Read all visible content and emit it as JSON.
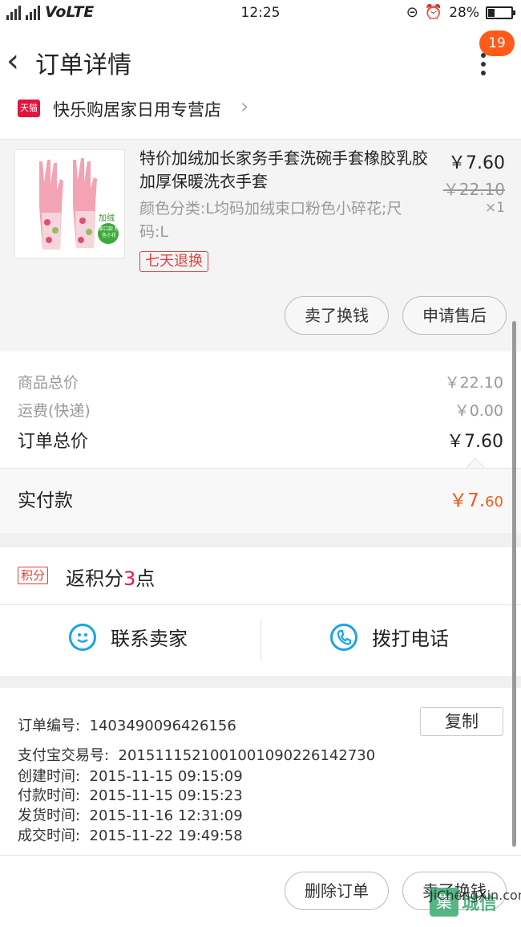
{
  "status_bar": {
    "network": "4G 3G",
    "volte": "VoLTE",
    "time": "12:25",
    "battery": "28%",
    "battery_level": 0.28
  },
  "header": {
    "title": "订单详情",
    "badge": "19"
  },
  "shop": {
    "badge": "天猫",
    "name": "快乐购居家日用专营店"
  },
  "product": {
    "title": "特价加绒加长家务手套洗碗手套橡胶乳胶加厚保暖洗衣手套",
    "sku": "颜色分类:L均码加绒束口粉色小碎花;尺码:L",
    "service_tag": "七天退换",
    "price": "￥7.60",
    "original_price": "￥22.10",
    "quantity": "×1",
    "thumb_text1": "加绒",
    "thumb_text2": "束口款 粉色小花",
    "actions": [
      "卖了换钱",
      "申请售后"
    ]
  },
  "summary": {
    "goods_total_label": "商品总价",
    "goods_total": "￥22.10",
    "shipping_label": "运费(快递)",
    "shipping": "￥0.00",
    "order_total_label": "订单总价",
    "order_total": "￥7.60",
    "paid_label": "实付款",
    "paid_main": "￥7.",
    "paid_cents": "60"
  },
  "points": {
    "badge": "积分",
    "text_prefix": "返积分",
    "value": "3",
    "text_suffix": "点"
  },
  "contact": {
    "chat": "联系卖家",
    "call": "拨打电话"
  },
  "order_info": {
    "number_label": "订单编号:",
    "number": "1403490096426156",
    "copy": "复制",
    "alipay_label": "支付宝交易号:",
    "alipay": "2015111521001001090226142730",
    "created_label": "创建时间:",
    "created": "2015-11-15 09:15:09",
    "paid_label": "付款时间:",
    "paid": "2015-11-15 09:15:23",
    "shipped_label": "发货时间:",
    "shipped": "2015-11-16 12:31:09",
    "done_label": "成交时间:",
    "done": "2015-11-22 19:49:58"
  },
  "footer": {
    "delete": "删除订单",
    "sell": "卖了换钱"
  },
  "watermark": {
    "mark": "集",
    "name": "城信",
    "url": "JiChengXin.com"
  },
  "colors": {
    "accent": "#ff5a1a",
    "tmall": "#e5123b",
    "link_blue": "#1aa3ea",
    "price_orange": "#f05a1a"
  }
}
